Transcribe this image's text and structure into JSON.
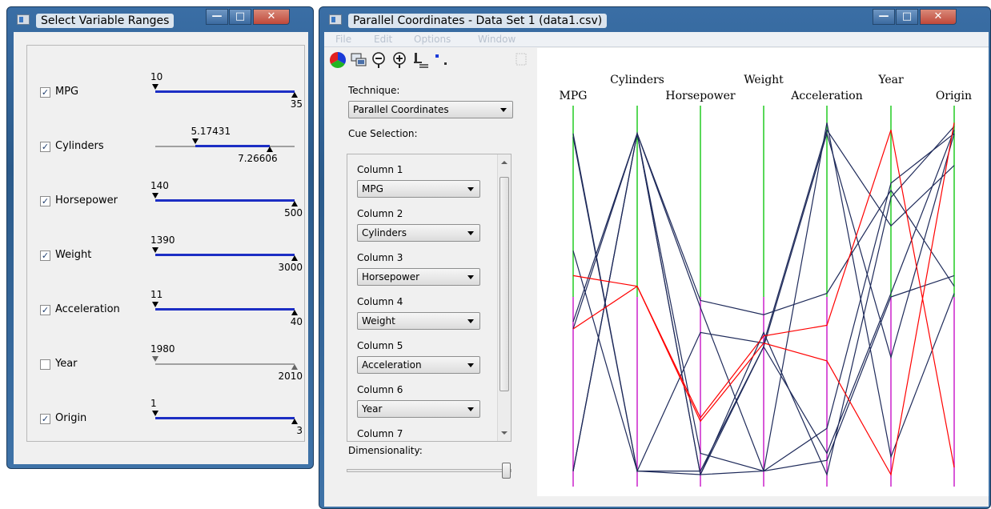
{
  "left_window": {
    "title": "Select Variable Ranges",
    "variables": [
      {
        "label": "MPG",
        "checked": true,
        "min": "10",
        "max": "35",
        "range_min_fraction": 0.0,
        "range_max_fraction": 1.0
      },
      {
        "label": "Cylinders",
        "checked": true,
        "min": "5.17431",
        "max": "7.26606",
        "range_min_fraction": 0.29,
        "range_max_fraction": 0.82
      },
      {
        "label": "Horsepower",
        "checked": true,
        "min": "140",
        "max": "500",
        "range_min_fraction": 0.0,
        "range_max_fraction": 1.0
      },
      {
        "label": "Weight",
        "checked": true,
        "min": "1390",
        "max": "3000",
        "range_min_fraction": 0.0,
        "range_max_fraction": 1.0
      },
      {
        "label": "Acceleration",
        "checked": true,
        "min": "11",
        "max": "40",
        "range_min_fraction": 0.0,
        "range_max_fraction": 1.0
      },
      {
        "label": "Year",
        "checked": false,
        "min": "1980",
        "max": "2010",
        "range_min_fraction": 0.0,
        "range_max_fraction": 1.0
      },
      {
        "label": "Origin",
        "checked": true,
        "min": "1",
        "max": "3",
        "range_min_fraction": 0.0,
        "range_max_fraction": 1.0
      }
    ]
  },
  "right_window": {
    "title": "Parallel Coordinates - Data Set 1 (data1.csv)",
    "menu": [
      "File",
      "Edit",
      "Options",
      "Window"
    ],
    "toolbar_icons": [
      "color-wheel-icon",
      "screens-icon",
      "zoom-out-icon",
      "zoom-in-icon",
      "axis-settings-icon",
      "scatter-icon",
      "grid-icon"
    ],
    "technique_label": "Technique:",
    "technique_value": "Parallel Coordinates",
    "cue_selection_label": "Cue Selection:",
    "columns": [
      {
        "label": "Column 1",
        "value": "MPG"
      },
      {
        "label": "Column 2",
        "value": "Cylinders"
      },
      {
        "label": "Column 3",
        "value": "Horsepower"
      },
      {
        "label": "Column 4",
        "value": "Weight"
      },
      {
        "label": "Column 5",
        "value": "Acceleration"
      },
      {
        "label": "Column 6",
        "value": "Year"
      },
      {
        "label": "Column 7",
        "value": ""
      }
    ],
    "dimensionality_label": "Dimensionality:",
    "dimensionality_value_fraction": 1.0
  },
  "colors": {
    "accent": "#1c2ec4",
    "frame": "#3a6ea5",
    "selected": "#ff0000",
    "line": "#1e2a5a",
    "axis_green": "#22cc22",
    "axis_magenta": "#cc22cc"
  },
  "chart_data": {
    "type": "parallel-coordinates",
    "axes": [
      "MPG",
      "Cylinders",
      "Horsepower",
      "Weight",
      "Acceleration",
      "Year",
      "Origin"
    ],
    "lines": [
      {
        "highlight": false,
        "values": [
          0.96,
          0.01,
          0.4,
          0.37,
          0.97,
          0.7,
          0.87
        ]
      },
      {
        "highlight": false,
        "values": [
          0.43,
          0.96,
          0.0,
          0.36,
          0.06,
          0.51,
          0.97
        ]
      },
      {
        "highlight": false,
        "values": [
          0.01,
          0.96,
          0.06,
          0.01,
          0.13,
          0.82,
          0.96
        ]
      },
      {
        "highlight": false,
        "values": [
          0.63,
          0.01,
          0.0,
          0.4,
          0.0,
          0.78,
          0.98
        ]
      },
      {
        "highlight": false,
        "values": [
          0.41,
          0.96,
          0.49,
          0.45,
          0.51,
          0.8,
          0.53
        ]
      },
      {
        "highlight": false,
        "values": [
          0.95,
          0.01,
          0.01,
          0.36,
          0.96,
          0.33,
          0.96
        ]
      },
      {
        "highlight": false,
        "values": [
          0.01,
          0.96,
          0.47,
          0.01,
          0.04,
          0.5,
          0.56
        ]
      },
      {
        "highlight": false,
        "values": [
          0.01,
          0.96,
          0.0,
          0.01,
          0.99,
          0.05,
          0.51
        ]
      },
      {
        "highlight": true,
        "values": [
          0.56,
          0.53,
          0.16,
          0.39,
          0.42,
          0.97,
          0.02
        ]
      },
      {
        "highlight": true,
        "values": [
          0.41,
          0.53,
          0.15,
          0.37,
          0.32,
          0.0,
          0.99
        ]
      }
    ]
  }
}
